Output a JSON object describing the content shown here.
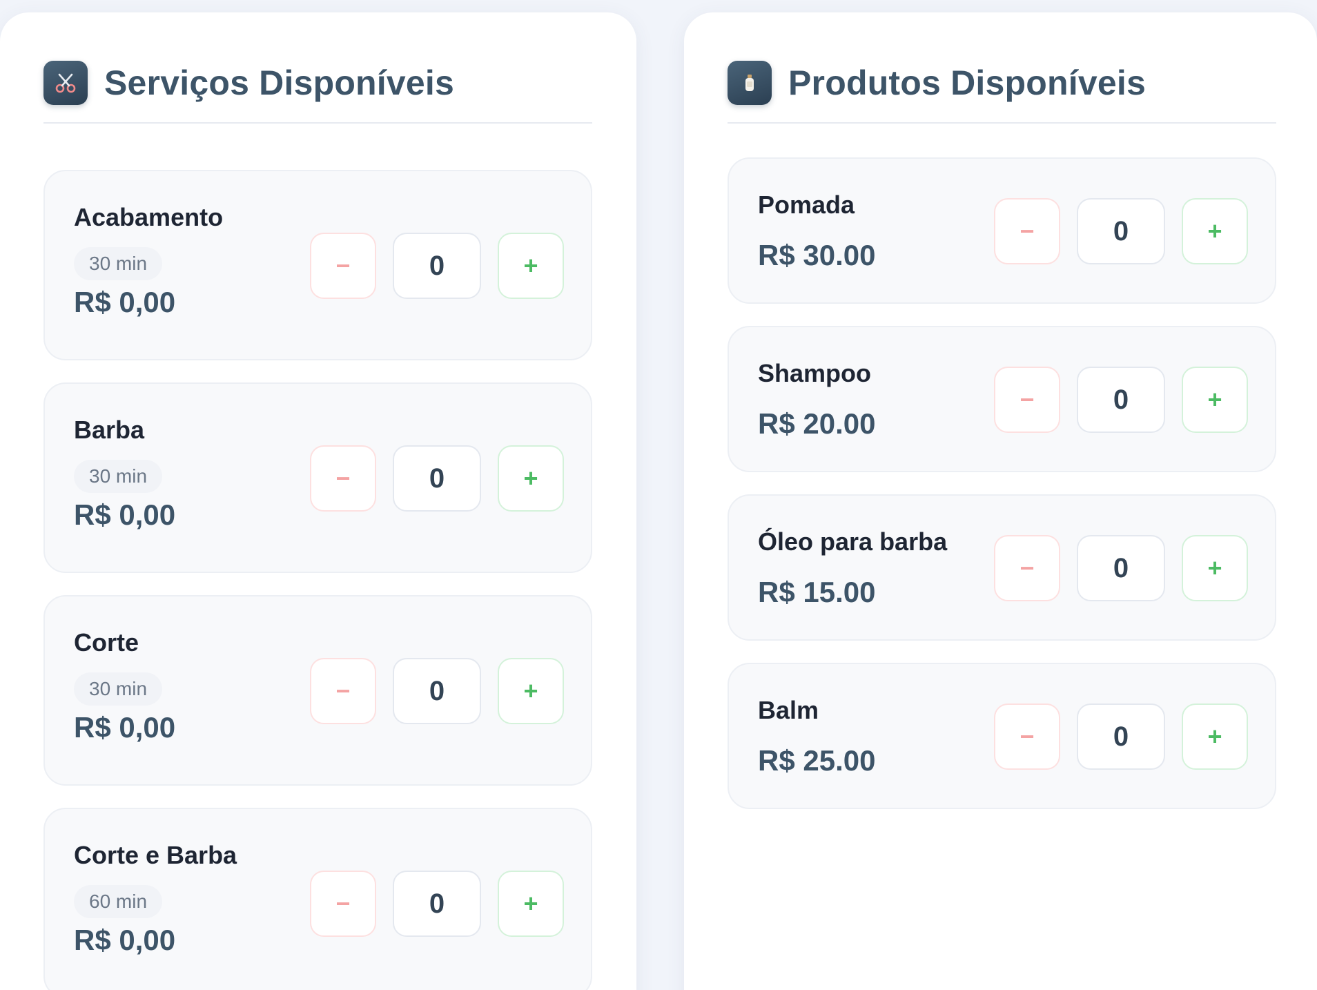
{
  "services": {
    "title": "Serviços Disponíveis",
    "icon": "scissors-icon",
    "items": [
      {
        "name": "Acabamento",
        "duration": "30 min",
        "price": "R$ 0,00",
        "quantity": "0"
      },
      {
        "name": "Barba",
        "duration": "30 min",
        "price": "R$ 0,00",
        "quantity": "0"
      },
      {
        "name": "Corte",
        "duration": "30 min",
        "price": "R$ 0,00",
        "quantity": "0"
      },
      {
        "name": "Corte e Barba",
        "duration": "60 min",
        "price": "R$ 0,00",
        "quantity": "0"
      }
    ]
  },
  "products": {
    "title": "Produtos Disponíveis",
    "icon": "bottle-icon",
    "items": [
      {
        "name": "Pomada",
        "price": "R$ 30.00",
        "quantity": "0"
      },
      {
        "name": "Shampoo",
        "price": "R$ 20.00",
        "quantity": "0"
      },
      {
        "name": "Óleo para barba",
        "price": "R$ 15.00",
        "quantity": "0"
      },
      {
        "name": "Balm",
        "price": "R$ 25.00",
        "quantity": "0"
      }
    ]
  },
  "controls": {
    "decrement_label": "−",
    "increment_label": "+"
  },
  "colors": {
    "accent": "#3d5468",
    "decrement": "#f4a3a3",
    "increment": "#4cbb63",
    "card_background": "#f8f9fb"
  }
}
